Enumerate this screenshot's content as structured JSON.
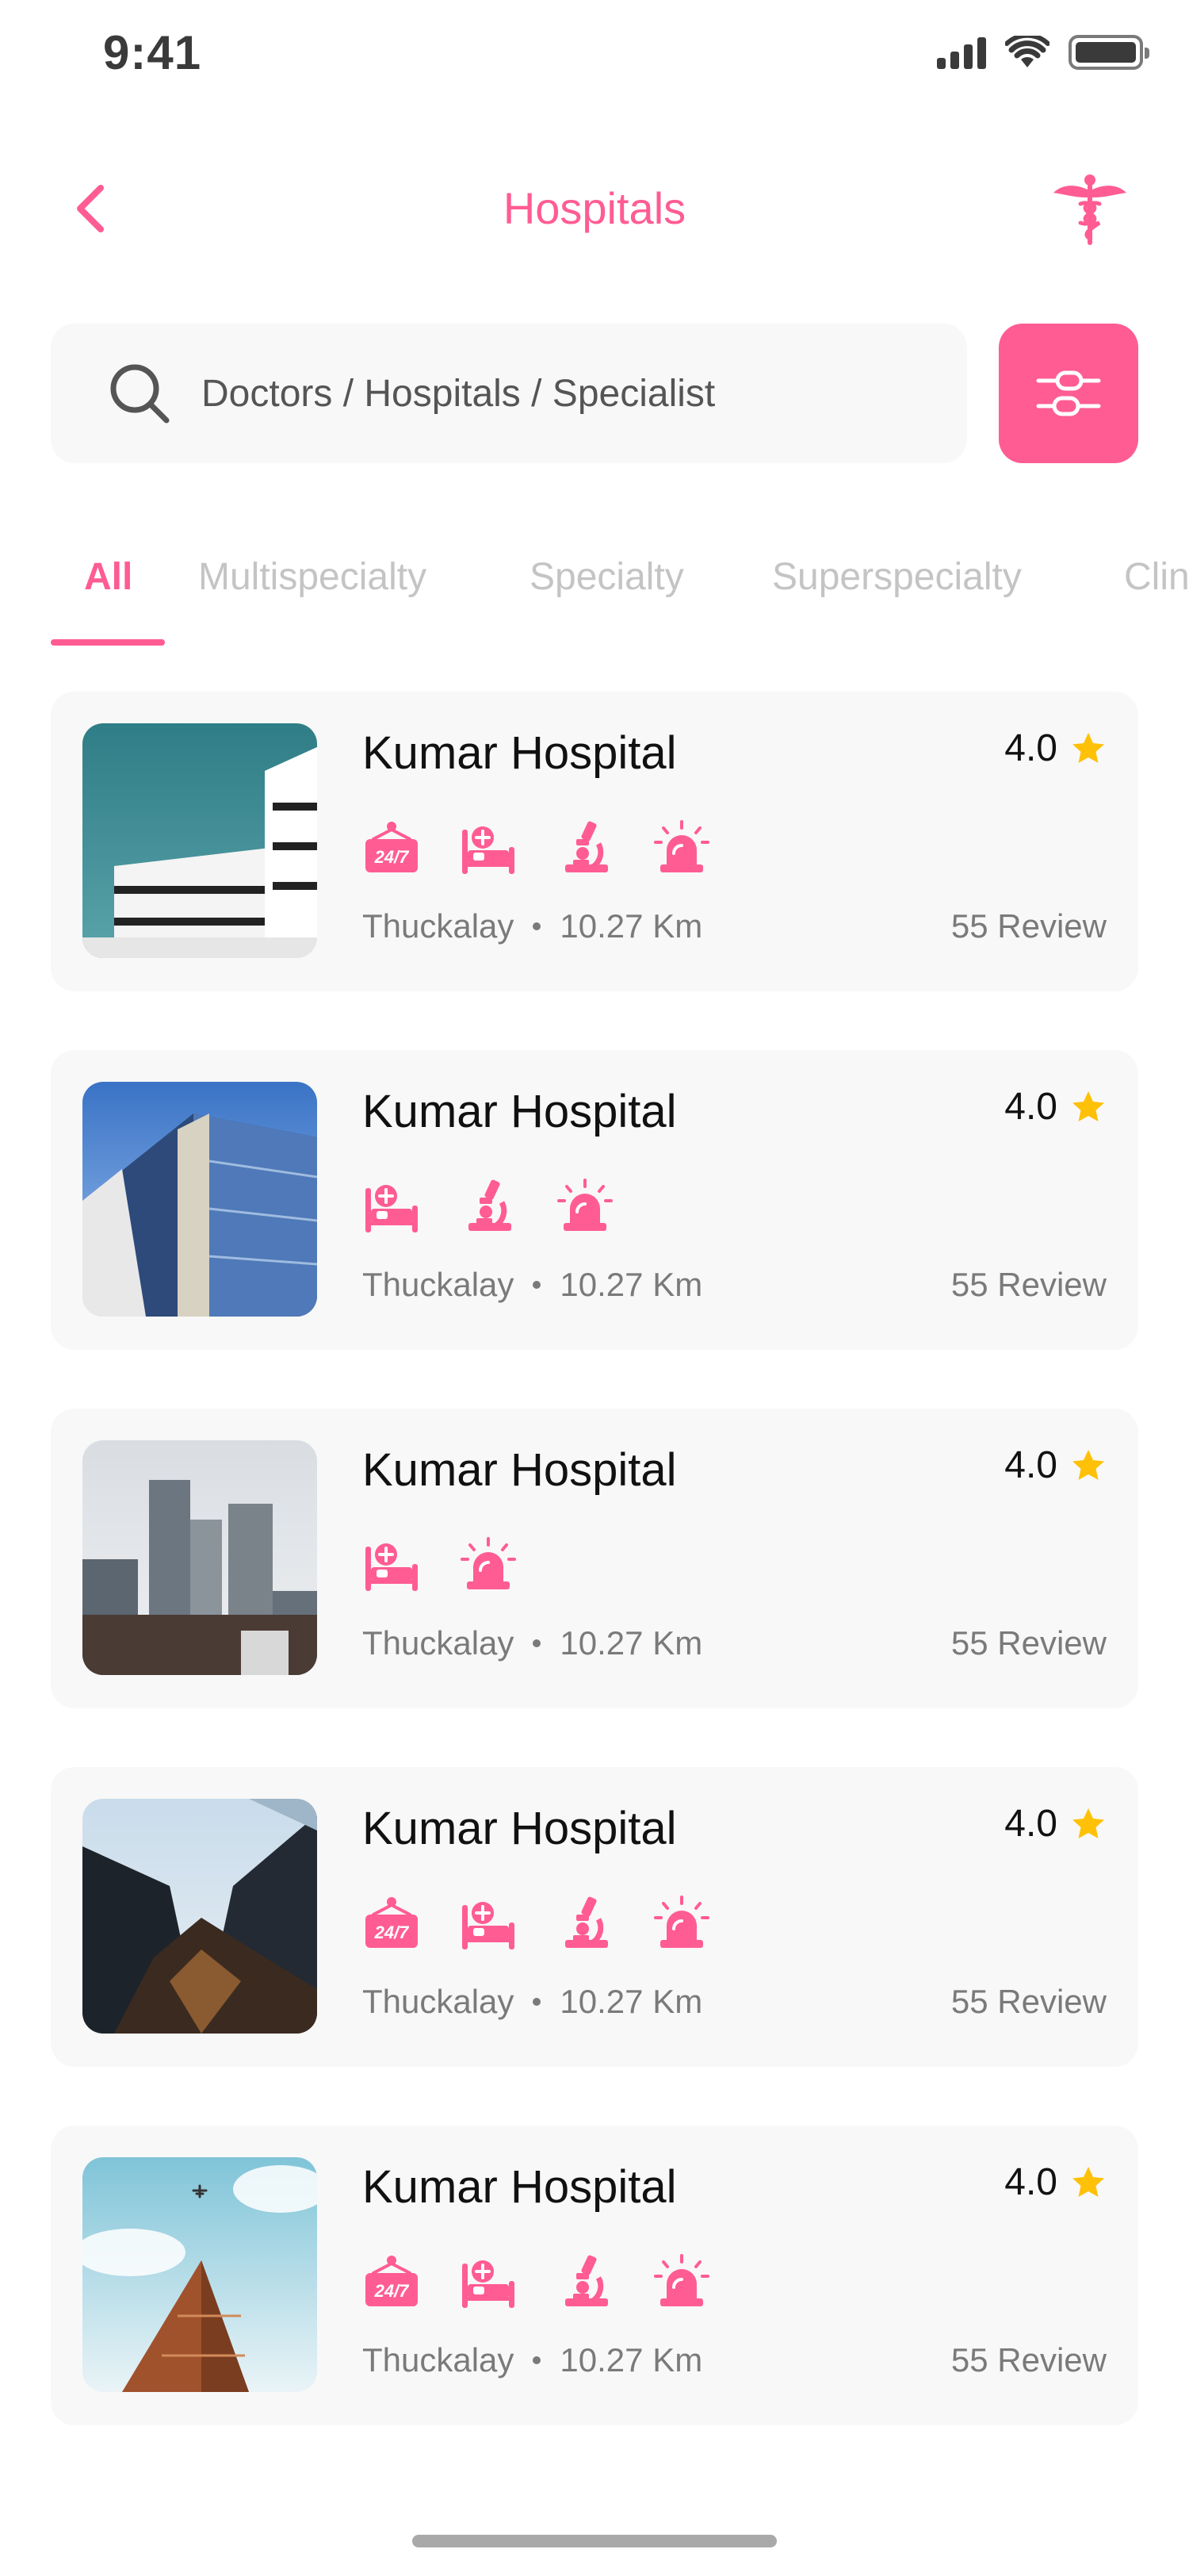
{
  "status_bar": {
    "time": "9:41",
    "icons": [
      "signal-icon",
      "wifi-icon",
      "battery-icon"
    ]
  },
  "header": {
    "title": "Hospitals",
    "back_icon": "chevron-left-icon",
    "action_icon": "caduceus-icon"
  },
  "search": {
    "placeholder": "Doctors / Hospitals / Specialist",
    "value": "",
    "icon": "search-icon",
    "filter_icon": "sliders-icon"
  },
  "tabs": [
    {
      "label": "All",
      "active": true
    },
    {
      "label": "Multispecialty",
      "active": false
    },
    {
      "label": "Specialty",
      "active": false
    },
    {
      "label": "Superspecialty",
      "active": false
    },
    {
      "label": "Clinic",
      "active": false
    }
  ],
  "colors": {
    "accent": "#ff5c93",
    "star": "#ffc107",
    "card_bg": "#f8f8f8",
    "muted_text": "#7a7a7a"
  },
  "hospitals": [
    {
      "name": "Kumar Hospital",
      "rating": "4.0",
      "location": "Thuckalay",
      "distance": "10.27 Km",
      "reviews": "55 Review",
      "amenities": [
        "24-7-icon",
        "hospital-bed-icon",
        "microscope-icon",
        "emergency-siren-icon"
      ]
    },
    {
      "name": "Kumar Hospital",
      "rating": "4.0",
      "location": "Thuckalay",
      "distance": "10.27 Km",
      "reviews": "55 Review",
      "amenities": [
        "hospital-bed-icon",
        "microscope-icon",
        "emergency-siren-icon"
      ]
    },
    {
      "name": "Kumar Hospital",
      "rating": "4.0",
      "location": "Thuckalay",
      "distance": "10.27 Km",
      "reviews": "55 Review",
      "amenities": [
        "hospital-bed-icon",
        "emergency-siren-icon"
      ]
    },
    {
      "name": "Kumar Hospital",
      "rating": "4.0",
      "location": "Thuckalay",
      "distance": "10.27 Km",
      "reviews": "55 Review",
      "amenities": [
        "24-7-icon",
        "hospital-bed-icon",
        "microscope-icon",
        "emergency-siren-icon"
      ]
    },
    {
      "name": "Kumar Hospital",
      "rating": "4.0",
      "location": "Thuckalay",
      "distance": "10.27 Km",
      "reviews": "55 Review",
      "amenities": [
        "24-7-icon",
        "hospital-bed-icon",
        "microscope-icon",
        "emergency-siren-icon"
      ]
    }
  ]
}
